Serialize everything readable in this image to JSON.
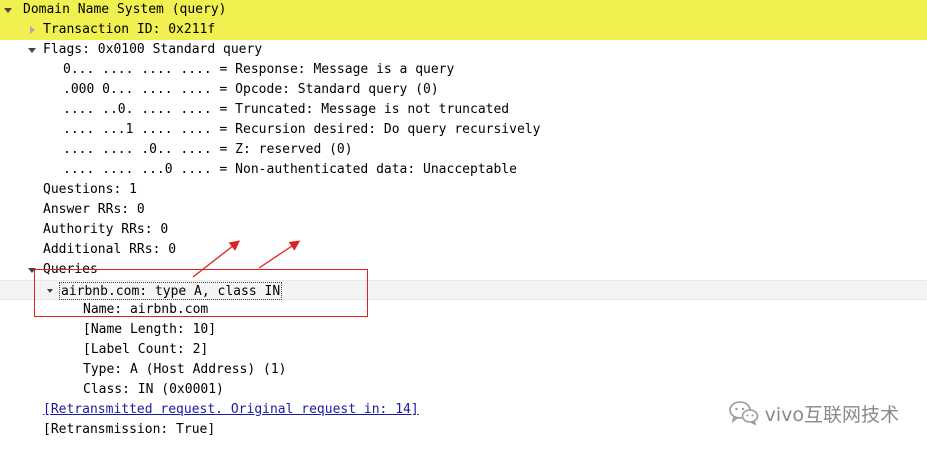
{
  "tree": {
    "dns": "Domain Name System (query)",
    "transaction_id": "Transaction ID: 0x211f",
    "flags": "Flags: 0x0100 Standard query",
    "flag_response": "0... .... .... .... = Response: Message is a query",
    "flag_opcode": ".000 0... .... .... = Opcode: Standard query (0)",
    "flag_truncated": ".... ..0. .... .... = Truncated: Message is not truncated",
    "flag_recursion": ".... ...1 .... .... = Recursion desired: Do query recursively",
    "flag_z": ".... .... .0.. .... = Z: reserved (0)",
    "flag_nonauth": ".... .... ...0 .... = Non-authenticated data: Unacceptable",
    "questions": "Questions: 1",
    "answer_rrs": "Answer RRs: 0",
    "authority_rrs": "Authority RRs: 0",
    "additional_rrs": "Additional RRs: 0",
    "queries": "Queries",
    "query_item": "airbnb.com: type A, class IN",
    "query_name": "Name: airbnb.com",
    "name_length": "[Name Length: 10]",
    "label_count": "[Label Count: 2]",
    "type": "Type: A (Host Address) (1)",
    "class": "Class: IN (0x0001)",
    "retransmitted_link": "[Retransmitted request. Original request in: 14]",
    "retransmission": "[Retransmission: True]"
  },
  "watermark": {
    "text": "vivo互联网技术",
    "icon": "wechat-icon"
  },
  "colors": {
    "highlight": "#f0f050",
    "annotation": "#e02020",
    "link": "#1a1aa6"
  }
}
